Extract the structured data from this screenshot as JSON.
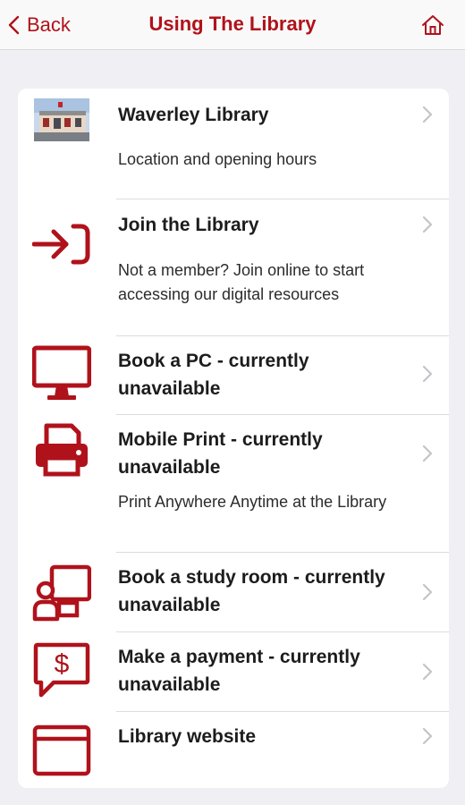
{
  "nav": {
    "back_label": "Back",
    "title": "Using The Library"
  },
  "colors": {
    "accent": "#b0121b",
    "background": "#efeff4",
    "card": "#ffffff"
  },
  "items": [
    {
      "icon": "library-photo",
      "title": "Waverley Library",
      "subtitle": "Location and opening hours"
    },
    {
      "icon": "sign-in-icon",
      "title": "Join the Library",
      "subtitle": "Not a member? Join online to start accessing our digital resources"
    },
    {
      "icon": "monitor-icon",
      "title": "Book a PC - currently unavailable",
      "subtitle": ""
    },
    {
      "icon": "printer-icon",
      "title": "Mobile Print - currently unavailable",
      "subtitle": "Print Anywhere Anytime at the Library"
    },
    {
      "icon": "study-room-icon",
      "title": "Book a study room - currently unavailable",
      "subtitle": ""
    },
    {
      "icon": "payment-icon",
      "title": "Make a payment - currently unavailable",
      "subtitle": ""
    },
    {
      "icon": "browser-window-icon",
      "title": "Library website",
      "subtitle": ""
    }
  ]
}
